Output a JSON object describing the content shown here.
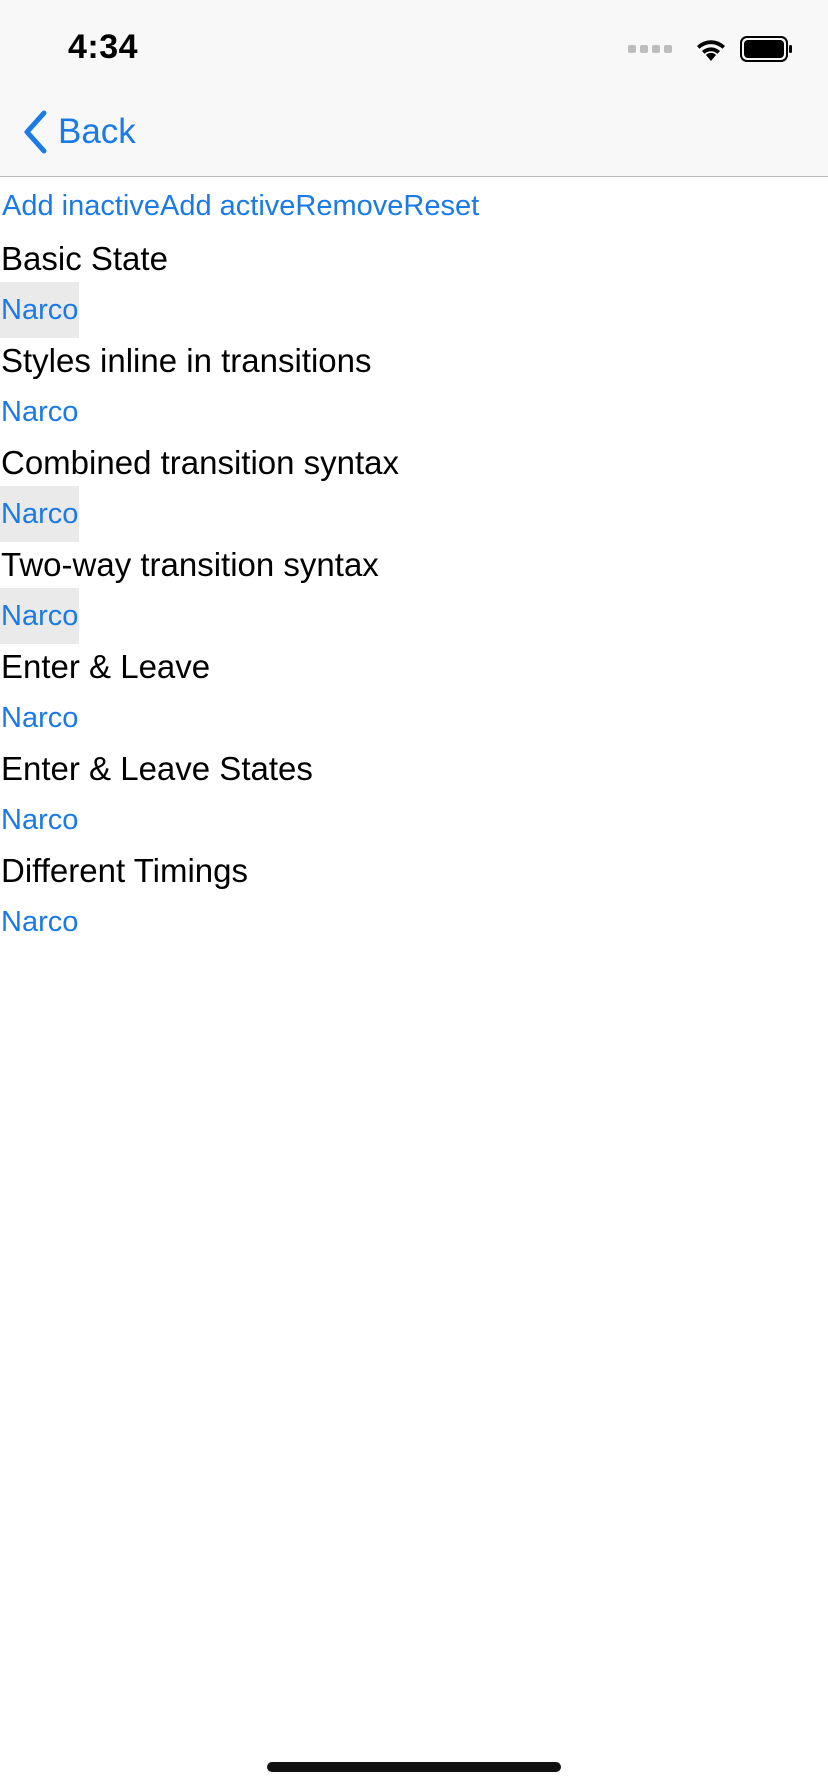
{
  "status_bar": {
    "time": "4:34"
  },
  "nav": {
    "back_label": "Back"
  },
  "actions": [
    {
      "label": "Add inactive"
    },
    {
      "label": "Add active"
    },
    {
      "label": "Remove"
    },
    {
      "label": "Reset"
    }
  ],
  "sections": [
    {
      "title": "Basic State",
      "item": "Narco",
      "shaded": true
    },
    {
      "title": "Styles inline in transitions",
      "item": "Narco",
      "shaded": false
    },
    {
      "title": "Combined transition syntax",
      "item": "Narco",
      "shaded": true
    },
    {
      "title": "Two-way transition syntax",
      "item": "Narco",
      "shaded": true
    },
    {
      "title": "Enter & Leave",
      "item": "Narco",
      "shaded": false
    },
    {
      "title": "Enter & Leave States",
      "item": "Narco",
      "shaded": false
    },
    {
      "title": "Different Timings",
      "item": "Narco",
      "shaded": false
    }
  ],
  "colors": {
    "accent": "#1a7ae6",
    "bar_background": "#f8f8f8",
    "shaded_item": "#eaeaea"
  }
}
